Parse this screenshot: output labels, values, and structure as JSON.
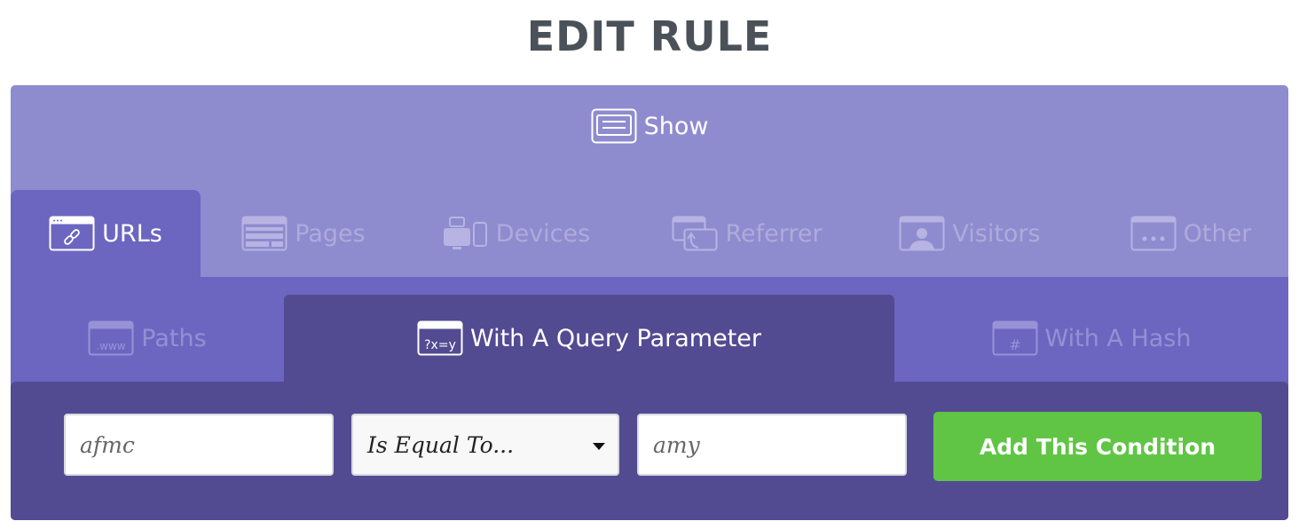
{
  "header": {
    "title": "EDIT RULE"
  },
  "show": {
    "label": "Show",
    "icon": "monitor-text-icon"
  },
  "primary_tabs": [
    {
      "label": "URLs",
      "icon": "link-window-icon",
      "active": true
    },
    {
      "label": "Pages",
      "icon": "page-layout-icon",
      "active": false
    },
    {
      "label": "Devices",
      "icon": "devices-icon",
      "active": false
    },
    {
      "label": "Referrer",
      "icon": "referrer-icon",
      "active": false
    },
    {
      "label": "Visitors",
      "icon": "visitor-icon",
      "active": false
    },
    {
      "label": "Other",
      "icon": "ellipsis-window-icon",
      "active": false
    }
  ],
  "secondary_tabs": [
    {
      "label": "Paths",
      "icon": "www-window-icon",
      "icon_text": ".www",
      "active": false
    },
    {
      "label": "With A Query Parameter",
      "icon": "query-window-icon",
      "icon_text": "?x=y",
      "active": true
    },
    {
      "label": "With A Hash",
      "icon": "hash-window-icon",
      "icon_text": "#",
      "active": false
    }
  ],
  "condition": {
    "parameter_value": "afmc",
    "operator_selected": "Is Equal To...",
    "value": "amy",
    "submit_label": "Add This Condition"
  },
  "colors": {
    "panel": "#8f8bcf",
    "active_tab": "#6c66c1",
    "active_subtab": "#524b92",
    "button": "#60c545",
    "title": "#4a5159"
  }
}
